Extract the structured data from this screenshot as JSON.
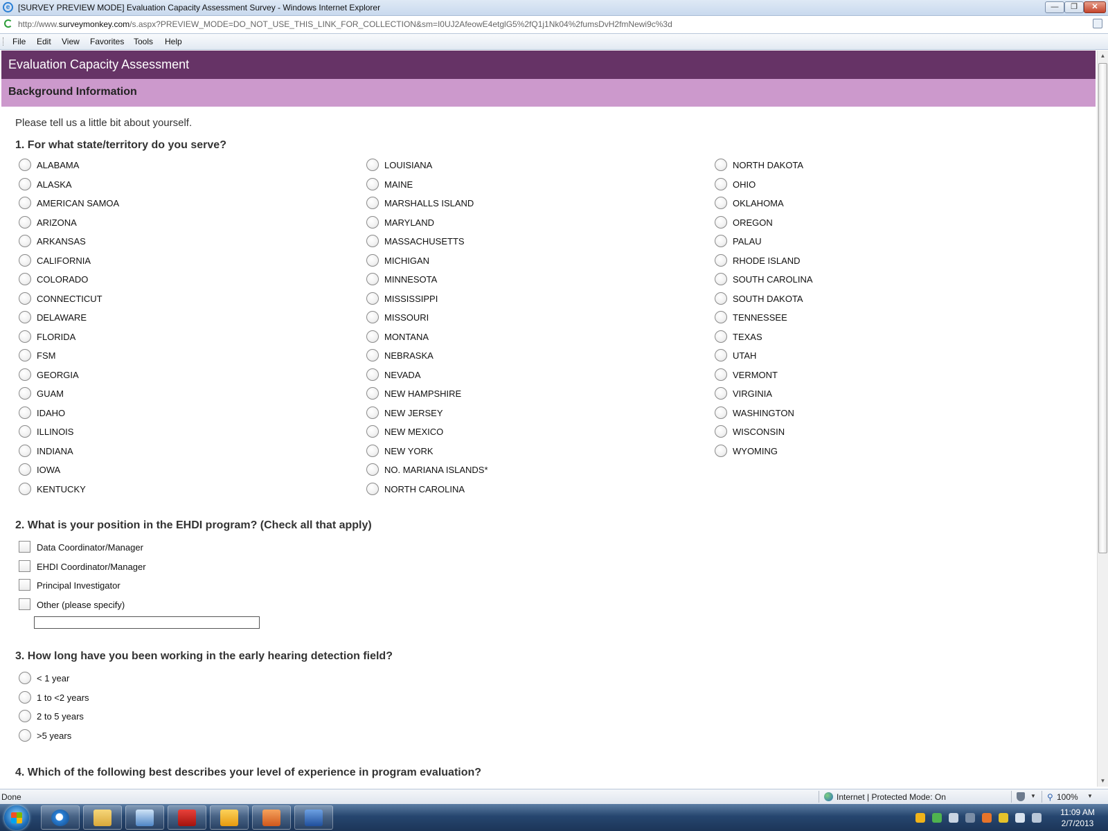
{
  "window": {
    "title": "[SURVEY PREVIEW MODE] Evaluation Capacity Assessment Survey - Windows Internet Explorer",
    "minimize": "—",
    "maximize": "❐",
    "close": "✕"
  },
  "address": {
    "url_prefix": "http://www.",
    "url_domain": "surveymonkey.com",
    "url_rest": "/s.aspx?PREVIEW_MODE=DO_NOT_USE_THIS_LINK_FOR_COLLECTION&sm=I0UJ2AfeowE4etglG5%2fQ1j1Nk04%2fumsDvH2fmNewi9c%3d"
  },
  "menu": [
    "File",
    "Edit",
    "View",
    "Favorites",
    "Tools",
    "Help"
  ],
  "survey": {
    "title": "Evaluation Capacity Assessment",
    "section": "Background Information",
    "intro": "Please tell us a little bit about yourself.",
    "q1": {
      "text": "1. For what state/territory do you serve?",
      "col1": [
        "ALABAMA",
        "ALASKA",
        "AMERICAN SAMOA",
        "ARIZONA",
        "ARKANSAS",
        "CALIFORNIA",
        "COLORADO",
        "CONNECTICUT",
        "DELAWARE",
        "FLORIDA",
        "FSM",
        "GEORGIA",
        "GUAM",
        "IDAHO",
        "ILLINOIS",
        "INDIANA",
        "IOWA",
        "KENTUCKY"
      ],
      "col2": [
        "LOUISIANA",
        "MAINE",
        "MARSHALLS ISLAND",
        "MARYLAND",
        "MASSACHUSETTS",
        "MICHIGAN",
        "MINNESOTA",
        "MISSISSIPPI",
        "MISSOURI",
        "MONTANA",
        "NEBRASKA",
        "NEVADA",
        "NEW HAMPSHIRE",
        "NEW JERSEY",
        "NEW MEXICO",
        "NEW YORK",
        "NO. MARIANA ISLANDS*",
        "NORTH CAROLINA"
      ],
      "col3": [
        "NORTH DAKOTA",
        "OHIO",
        "OKLAHOMA",
        "OREGON",
        "PALAU",
        "RHODE ISLAND",
        "SOUTH CAROLINA",
        "SOUTH DAKOTA",
        "TENNESSEE",
        "TEXAS",
        "UTAH",
        "VERMONT",
        "VIRGINIA",
        "WASHINGTON",
        "WISCONSIN",
        "WYOMING"
      ]
    },
    "q2": {
      "text": "2. What is your position in the EHDI program? (Check all that apply)",
      "options": [
        "Data Coordinator/Manager",
        "EHDI Coordinator/Manager",
        "Principal Investigator",
        "Other (please specify)"
      ],
      "other_value": ""
    },
    "q3": {
      "text": "3. How long have you been working in the early hearing detection field?",
      "options": [
        "< 1 year",
        "1 to <2 years",
        "2 to 5 years",
        ">5 years"
      ]
    },
    "q4_partial": "4. Which of the following best describes your level of experience in program evaluation?"
  },
  "status": {
    "left": "Done",
    "zone": "Internet | Protected Mode: On",
    "zoom": "100%"
  },
  "taskbar": {
    "time": "11:09 AM",
    "date": "2/7/2013",
    "apps": [
      "ie-icon",
      "explorer-icon",
      "remote-desktop-icon",
      "acrobat-icon",
      "outlook-icon",
      "snagit-icon",
      "word-icon"
    ]
  },
  "colors": {
    "header_dark": "#663366",
    "header_light": "#cc99cc"
  }
}
